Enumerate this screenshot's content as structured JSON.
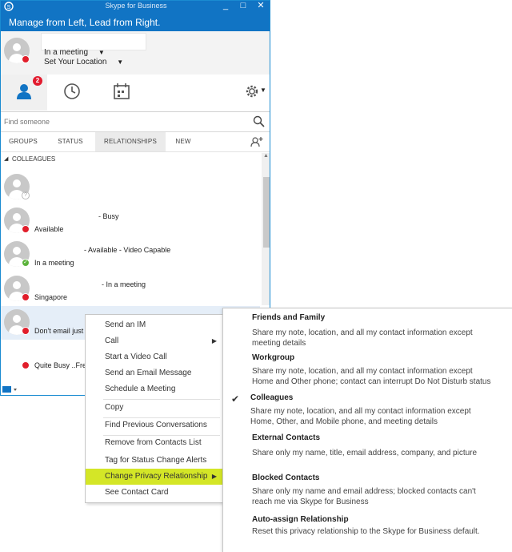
{
  "window": {
    "title": "Skype for Business",
    "minimize": "_",
    "maximize": "□",
    "close": "✕"
  },
  "banner": {
    "text": "Manage from Left, Lead from Right."
  },
  "me": {
    "status": "In a meeting",
    "location": "Set Your Location"
  },
  "tabs": {
    "badge": "2"
  },
  "search": {
    "placeholder": "Find someone"
  },
  "view_tabs": [
    "GROUPS",
    "STATUS",
    "RELATIONSHIPS",
    "NEW"
  ],
  "group": {
    "name": "COLLEAGUES"
  },
  "contacts": [
    {
      "line1": "",
      "line2": "",
      "status_color": "#ffffff"
    },
    {
      "line1": "- Busy",
      "line2": "Available",
      "status_color": "#e11e2b"
    },
    {
      "line1": "- Available - Video Capable",
      "line2": "In a meeting",
      "status_color": "#5bb33b"
    },
    {
      "line1": "- In a meeting",
      "line2": "Singapore",
      "status_color": "#e11e2b"
    },
    {
      "line1": "",
      "line2": "Don't email just",
      "status_color": "#e11e2b"
    },
    {
      "line1": "",
      "line2": "Quite Busy ..Free",
      "status_color": "#e11e2b"
    }
  ],
  "context_menu": {
    "items": [
      {
        "label": "Send an IM"
      },
      {
        "label": "Call"
      },
      {
        "label": "Start a Video Call"
      },
      {
        "label": "Send an Email Message"
      },
      {
        "label": "Schedule a Meeting"
      },
      {
        "label": "Copy"
      },
      {
        "label": "Find Previous Conversations"
      },
      {
        "label": "Remove from Contacts List"
      },
      {
        "label": "Tag for Status Change Alerts"
      },
      {
        "label": "Change Privacy Relationship"
      },
      {
        "label": "See Contact Card"
      }
    ]
  },
  "privacy_submenu": [
    {
      "title": "Friends and Family",
      "desc1": "Share my note, location, and all my contact information except",
      "desc2": "meeting details",
      "checked": false
    },
    {
      "title": "Workgroup",
      "desc1": "Share my note, location, and all my contact information except",
      "desc2": "Home and Other phone; contact can interrupt Do Not Disturb status",
      "checked": false
    },
    {
      "title": "Colleagues",
      "desc1": "Share my note, location, and all my contact information except",
      "desc2": "Home, Other, and Mobile phone, and meeting details",
      "checked": true
    },
    {
      "title": "External Contacts",
      "desc1": "Share only my name, title, email address, company, and picture",
      "desc2": "",
      "checked": false
    },
    {
      "title": "Blocked Contacts",
      "desc1": "Share only my name and email address; blocked contacts can't",
      "desc2": "reach me via Skype for Business",
      "checked": false
    },
    {
      "title": "Auto-assign Relationship",
      "desc1": "Reset this privacy relationship to the Skype for Business default.",
      "desc2": "",
      "checked": false
    }
  ],
  "colors": {
    "brand_blue": "#1174c4",
    "highlight": "#d4e627",
    "busy_red": "#e11e2b",
    "available_green": "#5bb33b"
  }
}
